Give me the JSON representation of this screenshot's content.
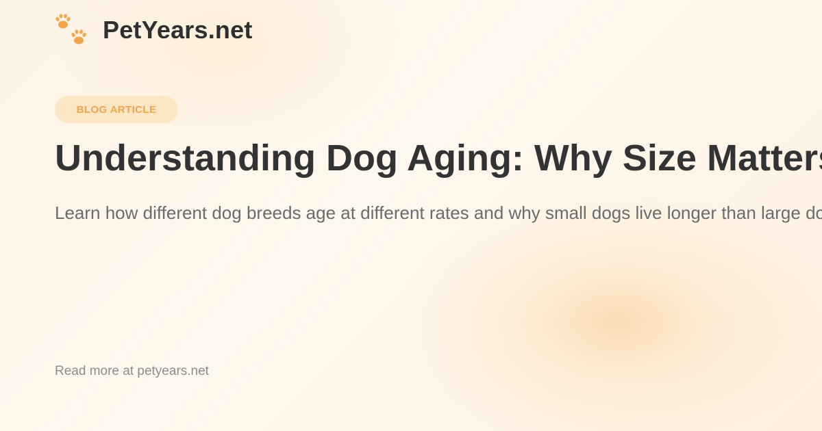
{
  "brand": {
    "icon": "paw-prints-icon",
    "name": "PetYears.net"
  },
  "badge": {
    "label": "BLOG ARTICLE"
  },
  "article": {
    "title": "Understanding Dog Aging: Why Size Matters",
    "subtitle": "Learn how different dog breeds age at different rates and why small dogs live longer than large dogs."
  },
  "footer": {
    "text": "Read more at petyears.net"
  },
  "colors": {
    "accent": "#f0a54a",
    "badge_background": "#fde6c4",
    "title": "#333333",
    "subtitle": "#6b6b6b",
    "footer": "#8d8d8d"
  }
}
